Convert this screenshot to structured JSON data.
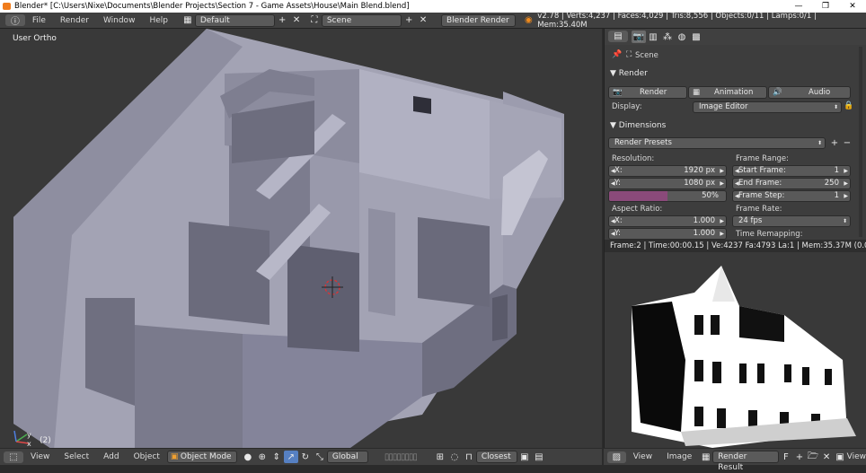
{
  "window": {
    "title": "Blender* [C:\\Users\\Nixe\\Documents\\Blender Projects\\Section 7 - Game Assets\\House\\Main Blend.blend]",
    "min": "—",
    "max": "❐",
    "close": "✕"
  },
  "info": {
    "menus": [
      "File",
      "Render",
      "Window",
      "Help"
    ],
    "layout": "Default",
    "scene": "Scene",
    "engine": "Blender Render",
    "stats": "v2.78 | Verts:4,237 | Faces:4,029 | Tris:8,556 | Objects:0/11 | Lamps:0/1 | Mem:35.40M"
  },
  "viewport": {
    "label": "User Ortho",
    "frame_label": "(2)",
    "axis_y": "y",
    "axis_x": "x",
    "menus": [
      "View",
      "Select",
      "Add",
      "Object"
    ],
    "mode": "Object Mode",
    "orientation": "Global",
    "snap": "Closest"
  },
  "props": {
    "breadcrumb": "Scene",
    "render_section": "Render",
    "render_btn": "Render",
    "animation_btn": "Animation",
    "audio_btn": "Audio",
    "display_label": "Display:",
    "display_value": "Image Editor",
    "dimensions_section": "Dimensions",
    "presets": "Render Presets",
    "resolution_label": "Resolution:",
    "res_x_label": "X:",
    "res_x": "1920 px",
    "res_y_label": "Y:",
    "res_y": "1080 px",
    "res_pct": "50%",
    "res_pct_value": 0.5,
    "frame_range_label": "Frame Range:",
    "start_label": "Start Frame:",
    "start": "1",
    "end_label": "End Frame:",
    "end": "250",
    "step_label": "Frame Step:",
    "step": "1",
    "aspect_label": "Aspect Ratio:",
    "asp_x_label": "X:",
    "asp_x": "1.000",
    "asp_y_label": "Y:",
    "asp_y": "1.000",
    "frame_rate_label": "Frame Rate:",
    "fps": "24 fps",
    "remap_label": "Time Remapping:",
    "accent": "#8a4a7a"
  },
  "image_editor": {
    "status": "Frame:2 | Time:00:00.15 | Ve:4237 Fa:4793 La:1 | Mem:35.37M (0.00M, Pea",
    "menus": [
      "View",
      "Image"
    ],
    "image_name": "Render Result",
    "f_label": "F",
    "view_label": "View"
  }
}
